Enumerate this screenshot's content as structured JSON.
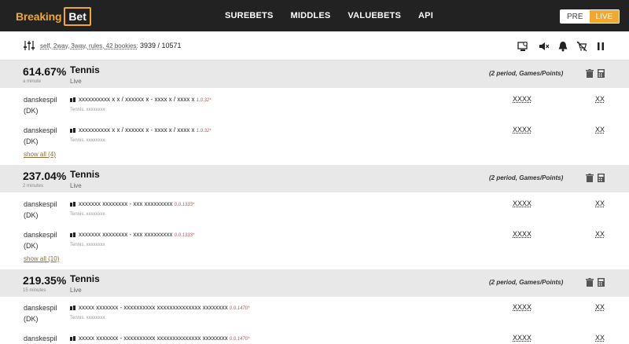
{
  "brand": {
    "part1": "Breaking",
    "part2": "Bet"
  },
  "nav": [
    "SUREBETS",
    "MIDDLES",
    "VALUEBETS",
    "API"
  ],
  "mode": {
    "pre": "PRE",
    "live": "LIVE"
  },
  "filter": {
    "text": "self, 2way, 3way, rules, 42 bookies:",
    "count": "3939 / 10571"
  },
  "groups": [
    {
      "pct": "614.67%",
      "sport": "Tennis",
      "time": "a minute",
      "status": "Live",
      "market": "(2 period, Games/Points)",
      "rows": [
        {
          "book1": "danskespil",
          "book2": "(DK)",
          "event": "xxxxxxxxxx x x / xxxxxx x - xxxx x / xxxx x",
          "note": "1.0.32*",
          "sub": "Tennis. xxxxxxxx",
          "odds": "XXXX",
          "stake": "XX"
        },
        {
          "book1": "danskespil",
          "book2": "(DK)",
          "event": "xxxxxxxxxx x x / xxxxxx x - xxxx x / xxxx x",
          "note": "1.0.32*",
          "sub": "Tennis. xxxxxxxx",
          "odds": "XXXX",
          "stake": "XX"
        }
      ],
      "show_all": "show all (4)"
    },
    {
      "pct": "237.04%",
      "sport": "Tennis",
      "time": "2 minutes",
      "status": "Live",
      "market": "(2 period, Games/Points)",
      "rows": [
        {
          "book1": "danskespil",
          "book2": "(DK)",
          "event": "xxxxxxx xxxxxxxx - xxx xxxxxxxxx",
          "note": "0.0.1333*",
          "sub": "Tennis. xxxxxxxx",
          "odds": "XXXX",
          "stake": "XX"
        },
        {
          "book1": "danskespil",
          "book2": "(DK)",
          "event": "xxxxxxx xxxxxxxx - xxx xxxxxxxxx",
          "note": "0.0.1333*",
          "sub": "Tennis. xxxxxxxx",
          "odds": "XXXX",
          "stake": "XX"
        }
      ],
      "show_all": "show all (10)"
    },
    {
      "pct": "219.35%",
      "sport": "Tennis",
      "time": "15 minutes",
      "status": "Live",
      "market": "(2 period, Games/Points)",
      "rows": [
        {
          "book1": "danskespil",
          "book2": "(DK)",
          "event": "xxxxx xxxxxxx - xxxxxxxxxx xxxxxxxxxxxxxx xxxxxxxx",
          "note": "0.0.1470*",
          "sub": "Tennis. xxxxxxxx",
          "odds": "XXXX",
          "stake": "XX"
        },
        {
          "book1": "danskespil",
          "book2": "",
          "event": "xxxxx xxxxxxx - xxxxxxxxxx xxxxxxxxxxxxxx xxxxxxxx",
          "note": "0.0.1470*",
          "sub": "",
          "odds": "XXXX",
          "stake": "XX"
        }
      ]
    }
  ],
  "colors": {
    "brand_orange": "#f0a830",
    "topbar": "#222222",
    "group_head": "#e8e8e8"
  }
}
